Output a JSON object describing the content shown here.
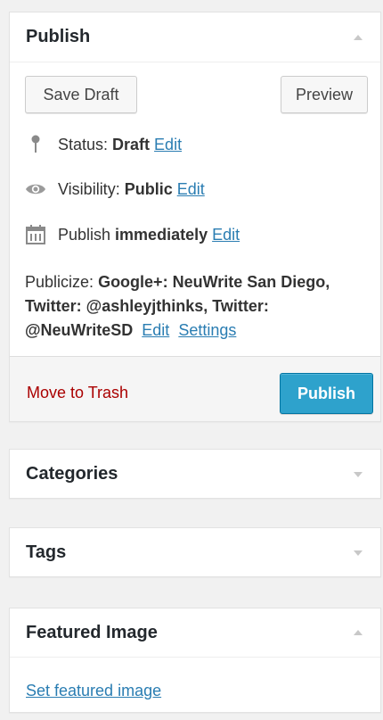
{
  "publish": {
    "title": "Publish",
    "save_draft": "Save Draft",
    "preview": "Preview",
    "status_label": "Status:",
    "status_value": "Draft",
    "visibility_label": "Visibility:",
    "visibility_value": "Public",
    "schedule_label": "Publish",
    "schedule_value": "immediately",
    "edit": "Edit",
    "publicize_label": "Publicize:",
    "publicize_accounts": "Google+: NeuWrite San Diego, Twitter: @ashleyjthinks, Twitter: @NeuWriteSD",
    "publicize_edit": "Edit",
    "publicize_settings": "Settings",
    "move_to_trash": "Move to Trash",
    "publish_button": "Publish",
    "colors": {
      "primary": "#2ea2cc",
      "link": "#2a7db2",
      "trash": "#aa0000"
    }
  },
  "categories": {
    "title": "Categories"
  },
  "tags": {
    "title": "Tags"
  },
  "featured_image": {
    "title": "Featured Image",
    "link": "Set featured image"
  },
  "icons": [
    "pin-icon",
    "eye-icon",
    "calendar-icon",
    "collapse-arrow-icon",
    "expand-arrow-icon"
  ]
}
